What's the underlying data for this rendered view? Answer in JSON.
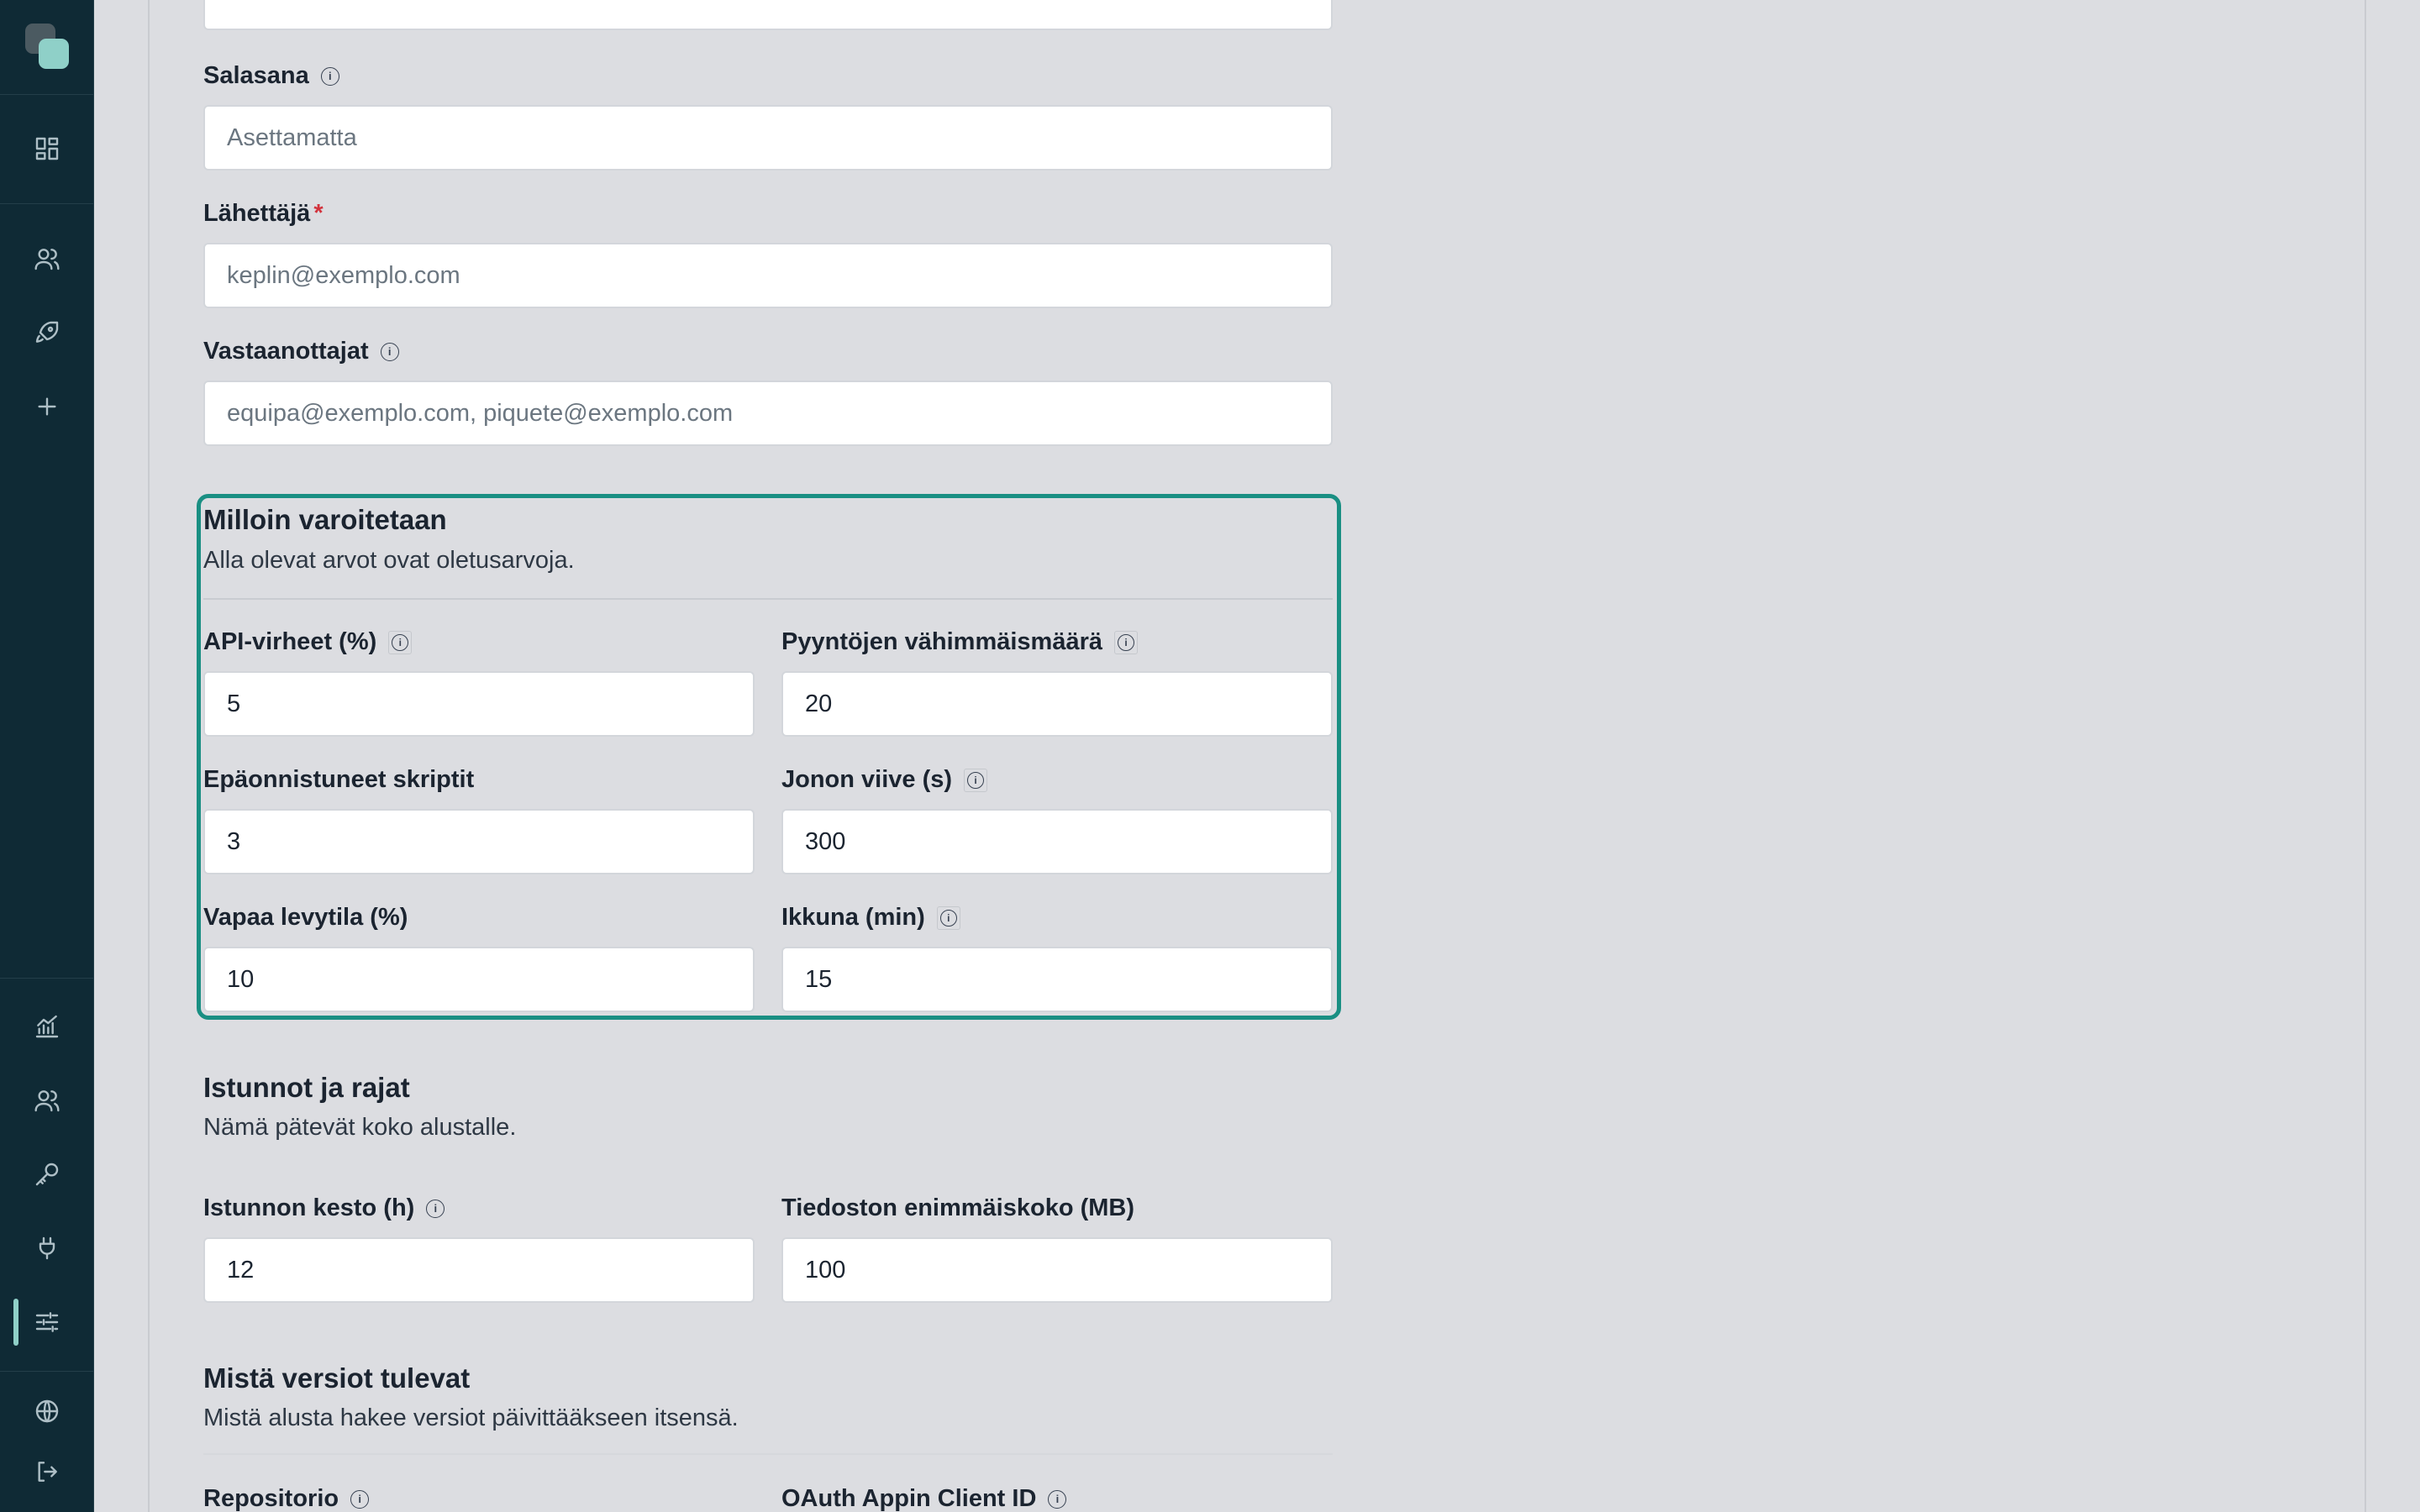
{
  "sidebar": {
    "logo": "app-logo",
    "top_items": [
      {
        "icon": "dashboard-icon"
      },
      {
        "icon": "users-icon"
      },
      {
        "icon": "rocket-icon"
      },
      {
        "icon": "plus-icon"
      }
    ],
    "bottom_items": [
      {
        "icon": "chart-icon"
      },
      {
        "icon": "users-icon"
      },
      {
        "icon": "key-icon"
      },
      {
        "icon": "plug-icon"
      },
      {
        "icon": "sliders-icon",
        "active": true
      },
      {
        "icon": "globe-icon"
      },
      {
        "icon": "logout-icon"
      }
    ]
  },
  "form": {
    "password": {
      "label": "Salasana",
      "placeholder": "Asettamatta"
    },
    "sender": {
      "label": "Lähettäjä",
      "required_mark": "*",
      "placeholder": "keplin@exemplo.com"
    },
    "recipients": {
      "label": "Vastaanottajat",
      "placeholder": "equipa@exemplo.com, piquete@exemplo.com"
    }
  },
  "alerts": {
    "title": "Milloin varoitetaan",
    "subtitle": "Alla olevat arvot ovat oletusarvoja.",
    "api_errors": {
      "label": "API-virheet (%)",
      "value": "5"
    },
    "min_requests": {
      "label": "Pyyntöjen vähimmäismäärä",
      "value": "20"
    },
    "failed_scripts": {
      "label": "Epäonnistuneet skriptit",
      "value": "3"
    },
    "queue_delay": {
      "label": "Jonon viive (s)",
      "value": "300"
    },
    "free_disk": {
      "label": "Vapaa levytila (%)",
      "value": "10"
    },
    "window": {
      "label": "Ikkuna (min)",
      "value": "15"
    }
  },
  "sessions": {
    "title": "Istunnot ja rajat",
    "subtitle": "Nämä pätevät koko alustalle.",
    "session_duration": {
      "label": "Istunnon kesto (h)",
      "value": "12"
    },
    "max_file_size": {
      "label": "Tiedoston enimmäiskoko (MB)",
      "value": "100"
    }
  },
  "versions": {
    "title": "Mistä versiot tulevat",
    "subtitle": "Mistä alusta hakee versiot päivittääkseen itsensä.",
    "repository": {
      "label": "Repositorio"
    },
    "oauth_client_id": {
      "label": "OAuth Appin Client ID"
    }
  },
  "info_glyph": "i"
}
